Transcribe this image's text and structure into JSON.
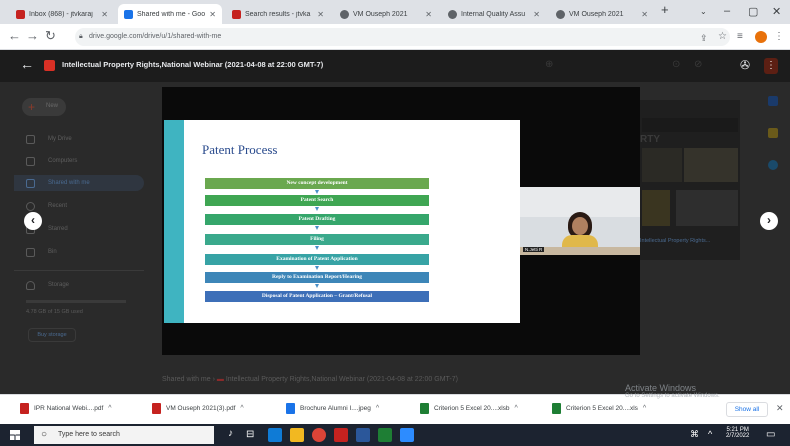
{
  "browser": {
    "tabs": [
      {
        "title": "Inbox (868) - jtvkaraj",
        "icon_color": "#c5221f",
        "active": false
      },
      {
        "title": "Shared with me - Goo",
        "icon_color": "#1a73e8",
        "active": true
      },
      {
        "title": "Search results - jtvka",
        "icon_color": "#c5221f",
        "active": false
      },
      {
        "title": "VM Ouseph 2021",
        "icon_color": "#5f6368",
        "active": false
      },
      {
        "title": "Internal Quality Assu",
        "icon_color": "#5f6368",
        "active": false
      },
      {
        "title": "VM Ouseph 2021",
        "icon_color": "#5f6368",
        "active": false
      }
    ],
    "url": "drive.google.com/drive/u/1/shared-with-me"
  },
  "preview": {
    "title": "Intellectual Property Rights,National Webinar (2021-04-08 at 22:00 GMT-7)"
  },
  "drive": {
    "new_label": "New",
    "sidebar": [
      "My Drive",
      "Computers",
      "Shared with me",
      "Recent",
      "Starred",
      "Bin",
      "Storage"
    ],
    "storage_text": "4.78 GB of 15 GB used",
    "buy_storage": "Buy storage",
    "breadcrumb_root": "Shared with me",
    "breadcrumb_item": "Intellectual Property Rights,National Webinar (2021-04-08 at 22:00 GMT-7)",
    "right_text": "RTY",
    "right_caption": "Intellectual Property Rights..."
  },
  "slide": {
    "title": "Patent Process",
    "steps": [
      {
        "label": "New concept development",
        "color": "#6aa84f"
      },
      {
        "label": "Patent Search",
        "color": "#3fa653"
      },
      {
        "label": "Patent Drafting",
        "color": "#35a66b"
      },
      {
        "label": "Filing",
        "color": "#3aa98c"
      },
      {
        "label": "Examination of Patent Application",
        "color": "#37a3a5"
      },
      {
        "label": "Reply to Examination Report/Hearing",
        "color": "#3d86b8"
      },
      {
        "label": "Disposal of Patent Application – Grant/Refusal",
        "color": "#3d6fb8"
      }
    ]
  },
  "participant": {
    "name": "N.Jetti R"
  },
  "downloads": [
    {
      "name": "IPR National Webi....pdf",
      "color": "#c5221f"
    },
    {
      "name": "VM Ouseph 2021(3).pdf",
      "color": "#c5221f"
    },
    {
      "name": "Brochure Alumni I....jpeg",
      "color": "#1a73e8"
    },
    {
      "name": "Criterion 5 Excel 20....xlsb",
      "color": "#1e7e34"
    },
    {
      "name": "Criterion 5 Excel 20....xls",
      "color": "#1e7e34"
    }
  ],
  "show_all": "Show all",
  "watermark": {
    "line1": "Activate Windows",
    "line2": "Go to Settings to activate Windows."
  },
  "taskbar": {
    "search_placeholder": "Type here to search",
    "time": "5:21 PM",
    "date": "2/7/2022"
  }
}
